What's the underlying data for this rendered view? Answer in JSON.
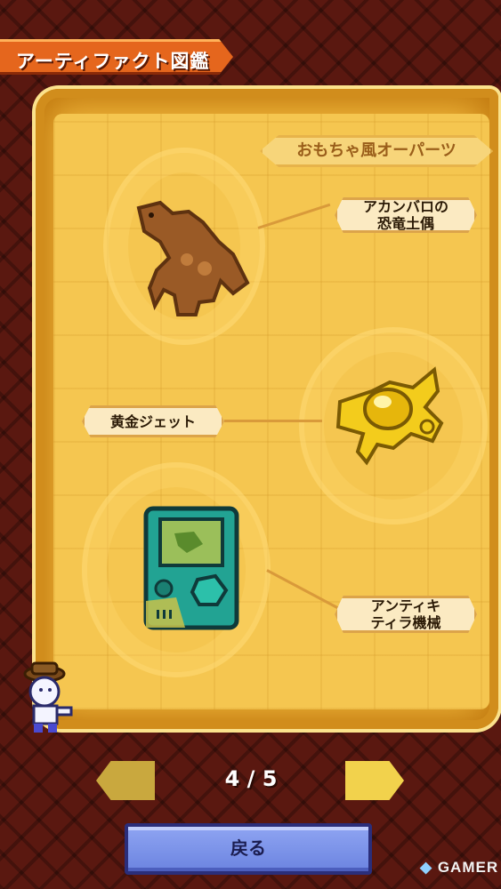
{
  "screen": {
    "title": "アーティファクト図鑑",
    "category": "おもちゃ風オーパーツ"
  },
  "artifacts": [
    {
      "name": "アカンバロの\n恐竜土偶",
      "icon": "clay-dinosaur-figurine-icon"
    },
    {
      "name": "黄金ジェット",
      "icon": "golden-jet-icon"
    },
    {
      "name": "アンティキ\nティラ機械",
      "icon": "handheld-device-icon"
    }
  ],
  "pagination": {
    "current": "4 / 5",
    "prev_icon": "arrow-left-icon",
    "next_icon": "arrow-right-icon"
  },
  "buttons": {
    "back_label": "戻る"
  },
  "watermark": "GAMER",
  "colors": {
    "parchment": "#f0b73c",
    "title_banner": "#e5661d",
    "back_button": "#7f96ea",
    "background": "#5a1810"
  }
}
